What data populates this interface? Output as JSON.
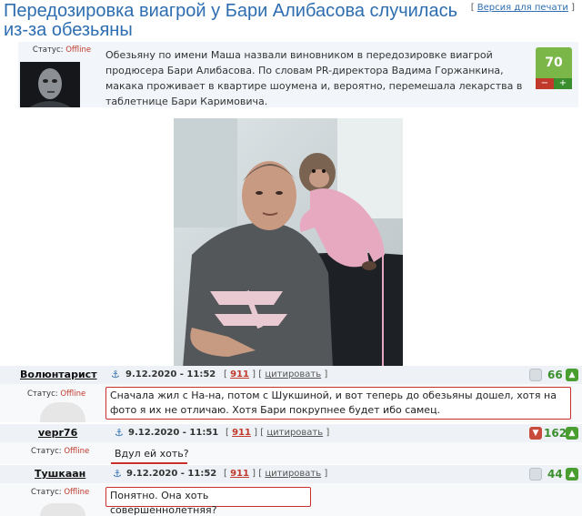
{
  "article": {
    "title": "Передозировка виагрой у Бари Алибасова случилась из-за обезьяны",
    "print_link_prefix": "[ ",
    "print_link": "Версия для печати",
    "print_link_suffix": " ]",
    "author_status_label": "Статус:",
    "author_status_value": "Offline",
    "body": "Обезьяну по имени Маша назвали виновником в передозировке виагрой продюсера Бари Алибасова. По словам PR-директора Вадима Горжанкина, макака проживает в квартире шоумена и, вероятно, перемешала лекарства в таблетнице Бари Каримовича.",
    "rating": "70",
    "rating_minus": "−",
    "rating_plus": "+"
  },
  "comments": [
    {
      "nick": "Волюнтарист",
      "date": "9.12.2020 - 11:52",
      "num": "911",
      "quote": "цитировать",
      "score": "66",
      "status_label": "Статус:",
      "status_value": "Offline",
      "text": "Сначала жил с На-на, потом с Шукшиной, и вот теперь до обезьяны дошел, хотя на фото я их не отличаю. Хотя Бари покрупнее будет ибо самец."
    },
    {
      "nick": "vepr76",
      "date": "9.12.2020 - 11:51",
      "num": "911",
      "quote": "цитировать",
      "score": "162",
      "status_label": "Статус:",
      "status_value": "Offline",
      "text": "Вдул ей хоть?"
    },
    {
      "nick": "Тушкаан",
      "date": "9.12.2020 - 11:52",
      "num": "911",
      "quote": "цитировать",
      "score": "44",
      "status_label": "Статус:",
      "status_value": "Offline",
      "text": "Понятно. Она хоть совершеннолетняя?"
    }
  ],
  "colors": {
    "link_blue": "#2d6db0",
    "rating_green": "#7ab648",
    "offline_red": "#c0392b",
    "highlight_red": "#c9302c"
  },
  "icons": {
    "anchor": "anchor-icon",
    "thumb_down": "vote-down-icon",
    "thumb_up": "vote-up-icon"
  }
}
